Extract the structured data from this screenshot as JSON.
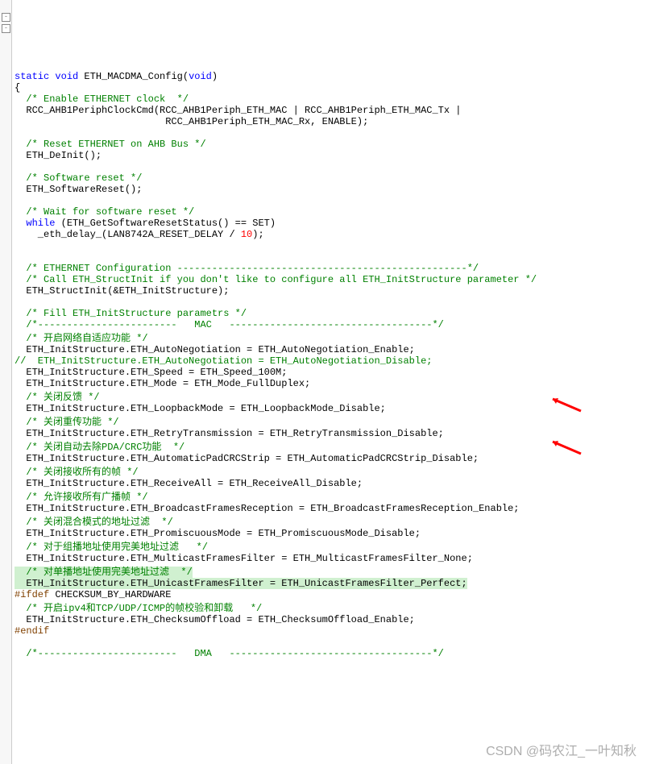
{
  "fold_glyph": "-",
  "code": {
    "l01_kw1": "static",
    "l01_kw2": "void",
    "l01_fn": " ETH_MACDMA_Config(",
    "l01_kw3": "void",
    "l01_end": ")",
    "l02": "{",
    "l03_cm": "  /* Enable ETHERNET clock  */",
    "l04": "  RCC_AHB1PeriphClockCmd(RCC_AHB1Periph_ETH_MAC | RCC_AHB1Periph_ETH_MAC_Tx |",
    "l05": "                          RCC_AHB1Periph_ETH_MAC_Rx, ENABLE);",
    "l06": "",
    "l07_cm": "  /* Reset ETHERNET on AHB Bus */",
    "l08": "  ETH_DeInit();",
    "l09": "",
    "l10_cm": "  /* Software reset */",
    "l11": "  ETH_SoftwareReset();",
    "l12": "",
    "l13_cm": "  /* Wait for software reset */",
    "l14_kw": "  while",
    "l14_rest": " (ETH_GetSoftwareResetStatus() == SET)",
    "l15_a": "    _eth_delay_(LAN8742A_RESET_DELAY / ",
    "l15_num": "10",
    "l15_b": ");",
    "l16": "",
    "l17": "",
    "l18_cm": "  /* ETHERNET Configuration --------------------------------------------------*/",
    "l19_cm": "  /* Call ETH_StructInit if you don't like to configure all ETH_InitStructure parameter */",
    "l20": "  ETH_StructInit(&ETH_InitStructure);",
    "l21": "",
    "l22_cm": "  /* Fill ETH_InitStructure parametrs */",
    "l23_cm": "  /*------------------------   MAC   -----------------------------------*/",
    "l24_cm": "  /* 开启网络自适应功能 */",
    "l25": "  ETH_InitStructure.ETH_AutoNegotiation = ETH_AutoNegotiation_Enable;",
    "l26_cm": "//  ETH_InitStructure.ETH_AutoNegotiation = ETH_AutoNegotiation_Disable;",
    "l27": "  ETH_InitStructure.ETH_Speed = ETH_Speed_100M;",
    "l28": "  ETH_InitStructure.ETH_Mode = ETH_Mode_FullDuplex;",
    "l29_cm": "  /* 关闭反馈 */",
    "l30": "  ETH_InitStructure.ETH_LoopbackMode = ETH_LoopbackMode_Disable;",
    "l31_cm": "  /* 关闭重传功能 */",
    "l32": "  ETH_InitStructure.ETH_RetryTransmission = ETH_RetryTransmission_Disable;",
    "l33_cm": "  /* 关闭自动去除PDA/CRC功能  */",
    "l34": "  ETH_InitStructure.ETH_AutomaticPadCRCStrip = ETH_AutomaticPadCRCStrip_Disable;",
    "l35_cm": "  /* 关闭接收所有的帧 */",
    "l36": "  ETH_InitStructure.ETH_ReceiveAll = ETH_ReceiveAll_Disable;",
    "l37_cm": "  /* 允许接收所有广播帧 */",
    "l38": "  ETH_InitStructure.ETH_BroadcastFramesReception = ETH_BroadcastFramesReception_Enable;",
    "l39_cm": "  /* 关闭混合模式的地址过滤  */",
    "l40": "  ETH_InitStructure.ETH_PromiscuousMode = ETH_PromiscuousMode_Disable;",
    "l41_cm": "  /* 对于组播地址使用完美地址过滤   */",
    "l42": "  ETH_InitStructure.ETH_MulticastFramesFilter = ETH_MulticastFramesFilter_None;",
    "l43_cm": "  /* 对单播地址使用完美地址过滤  */",
    "l44": "  ETH_InitStructure.ETH_UnicastFramesFilter = ETH_UnicastFramesFilter_Perfect;",
    "l45_pp": "#ifdef",
    "l45_rest": " CHECKSUM_BY_HARDWARE",
    "l46_cm": "  /* 开启ipv4和TCP/UDP/ICMP的帧校验和卸载   */",
    "l47": "  ETH_InitStructure.ETH_ChecksumOffload = ETH_ChecksumOffload_Enable;",
    "l48_pp": "#endif",
    "l49": "",
    "l50_cm": "  /*------------------------   DMA   -----------------------------------*/"
  },
  "watermark": "CSDN @码农江_一叶知秋"
}
